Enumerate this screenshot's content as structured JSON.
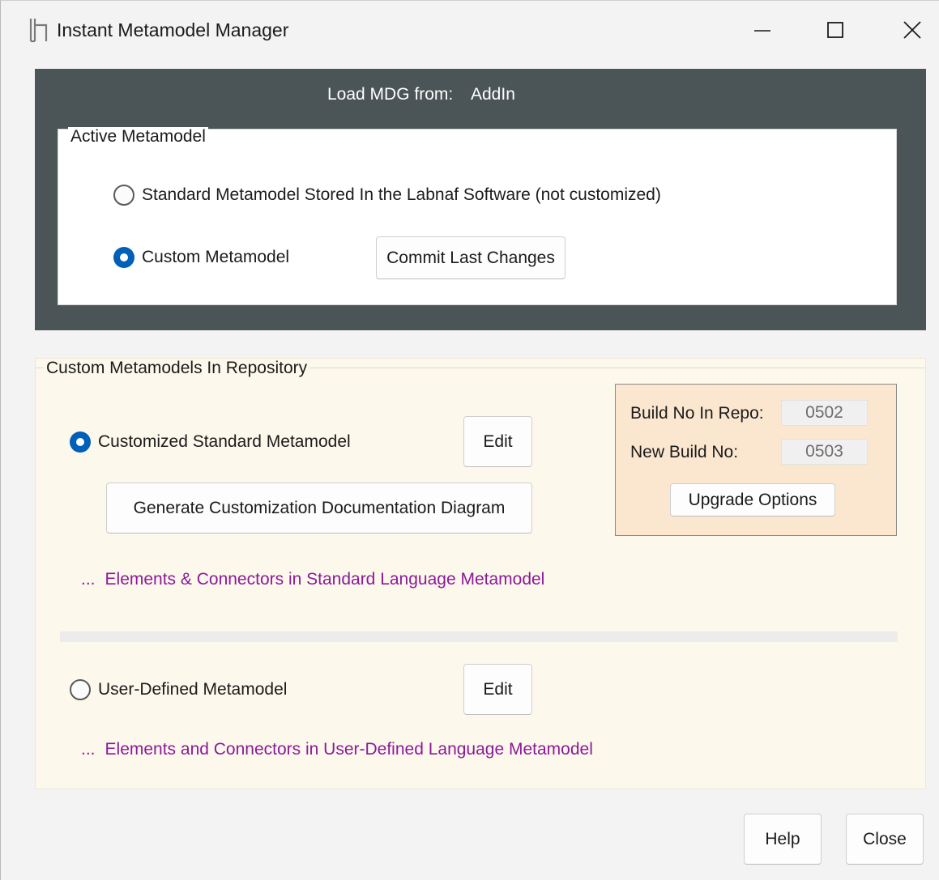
{
  "window": {
    "title": "Instant Metamodel Manager"
  },
  "header": {
    "load_label": "Load MDG from:",
    "load_value": "AddIn"
  },
  "active_metamodel": {
    "legend": "Active Metamodel",
    "option_standard": "Standard Metamodel Stored In the Labnaf Software (not customized)",
    "option_custom": "Custom Metamodel",
    "selected": "custom",
    "commit_button": "Commit Last Changes"
  },
  "repository": {
    "legend": "Custom Metamodels In Repository",
    "customized": {
      "label": "Customized Standard Metamodel",
      "selected": true,
      "edit_button": "Edit",
      "generate_button": "Generate Customization Documentation Diagram",
      "link_dots": "...",
      "link_text": "Elements & Connectors in Standard Language Metamodel"
    },
    "build": {
      "repo_label": "Build No In Repo:",
      "repo_value": "0502",
      "new_label": "New Build No:",
      "new_value": "0503",
      "upgrade_button": "Upgrade Options"
    },
    "user_defined": {
      "label": "User-Defined Metamodel",
      "selected": false,
      "edit_button": "Edit",
      "link_dots": "...",
      "link_text": "Elements and Connectors in User-Defined Language Metamodel"
    }
  },
  "footer": {
    "help_button": "Help",
    "close_button": "Close"
  },
  "colors": {
    "dark_panel": "#4b5457",
    "repo_panel": "#fdf8ec",
    "build_panel": "#fbe7d0",
    "radio_accent": "#005fb8",
    "link": "#8b1a99"
  },
  "icons": {
    "app": "labnaf-logo-icon",
    "minimize": "minimize-icon",
    "maximize": "maximize-icon",
    "close": "close-icon"
  }
}
